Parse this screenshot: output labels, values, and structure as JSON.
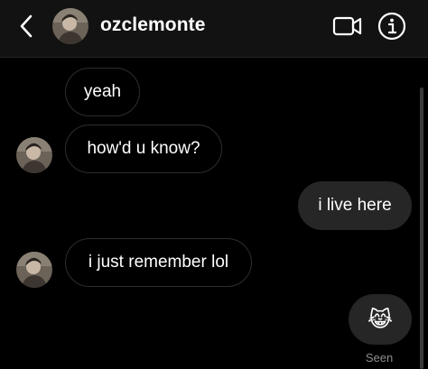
{
  "header": {
    "back_icon": "chevron-left-icon",
    "username": "ozclemonte",
    "video_icon": "video-camera-icon",
    "info_icon": "info-icon"
  },
  "messages": [
    {
      "text": "yeah",
      "direction": "received",
      "show_avatar": false
    },
    {
      "text": "how'd u know?",
      "direction": "received",
      "show_avatar": true
    },
    {
      "text": "i live here",
      "direction": "sent",
      "show_avatar": false
    },
    {
      "text": "i just remember lol",
      "direction": "received",
      "show_avatar": true
    },
    {
      "text": "😹",
      "direction": "sent",
      "show_avatar": false
    }
  ],
  "seen_label": "Seen",
  "colors": {
    "background": "#000000",
    "header_background": "#121212",
    "sent_bubble": "#262626",
    "received_bubble_border": "#2d2d2d",
    "text": "#ffffff",
    "muted_text": "#8e8e8e"
  }
}
